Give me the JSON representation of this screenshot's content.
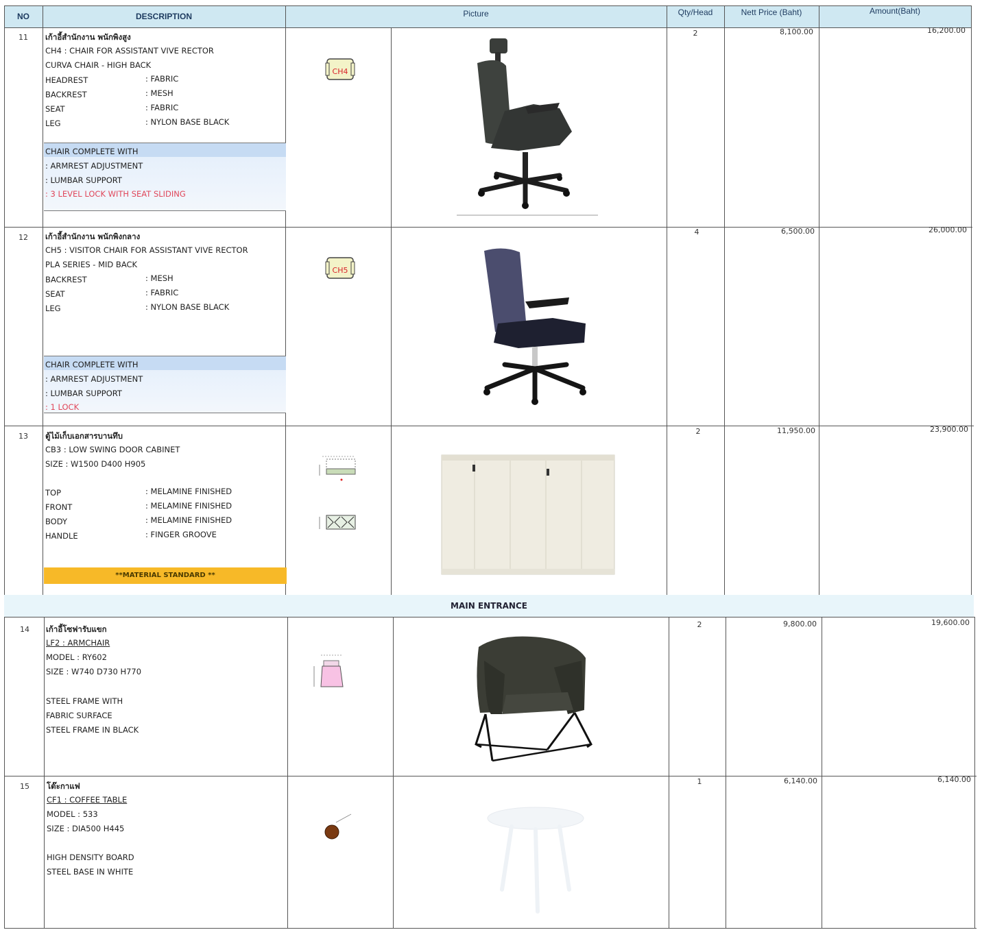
{
  "header": {
    "no": "NO",
    "description": "DESCRIPTION",
    "picture": "Picture",
    "qty": "Qty/Head",
    "price": "Nett Price (Baht)",
    "amount": "Amount(Baht)"
  },
  "section": {
    "main_entrance": "MAIN ENTRANCE"
  },
  "items": [
    {
      "no": "11",
      "thai": "เก้าอี้สำนักงาน พนักพิงสูง",
      "line1": "CH4 : CHAIR FOR ASSISTANT VIVE RECTOR",
      "line2": "CURVA CHAIR - HIGH BACK",
      "specs": [
        {
          "k": "HEADREST",
          "v": ": FABRIC"
        },
        {
          "k": "BACKREST",
          "v": ": MESH"
        },
        {
          "k": "SEAT",
          "v": ": FABRIC"
        },
        {
          "k": "LEG",
          "v": ": NYLON BASE BLACK"
        }
      ],
      "complete_head": "CHAIR COMPLETE WITH",
      "complete": [
        ": ARMREST ADJUSTMENT",
        ": LUMBAR SUPPORT",
        ": 3 LEVEL LOCK WITH SEAT SLIDING"
      ],
      "tag": "CH4",
      "qty": "2",
      "price": "8,100.00",
      "amount": "16,200.00"
    },
    {
      "no": "12",
      "thai": "เก้าอี้สำนักงาน พนักพิงกลาง",
      "line1": "CH5  : VISITOR CHAIR FOR ASSISTANT VIVE RECTOR",
      "line2": "PLA SERIES - MID BACK",
      "specs": [
        {
          "k": "BACKREST",
          "v": ": MESH"
        },
        {
          "k": "SEAT",
          "v": ": FABRIC"
        },
        {
          "k": "LEG",
          "v": ": NYLON BASE BLACK"
        }
      ],
      "complete_head": "CHAIR COMPLETE WITH",
      "complete": [
        ": ARMREST ADJUSTMENT",
        ": LUMBAR SUPPORT",
        ": 1 LOCK"
      ],
      "tag": "CH5",
      "qty": "4",
      "price": "6,500.00",
      "amount": "26,000.00"
    },
    {
      "no": "13",
      "thai": "ตู้ไม้เก็บเอกสารบานทึบ",
      "line1": "CB3 : LOW SWING DOOR CABINET",
      "line2": "SIZE : W1500 D400 H905",
      "specs": [
        {
          "k": "TOP",
          "v": ": MELAMINE FINISHED"
        },
        {
          "k": "FRONT",
          "v": ": MELAMINE FINISHED"
        },
        {
          "k": "BODY",
          "v": ": MELAMINE FINISHED"
        },
        {
          "k": "HANDLE",
          "v": ": FINGER GROOVE"
        }
      ],
      "material": "**MATERIAL STANDARD **",
      "qty": "2",
      "price": "11,950.00",
      "amount": "23,900.00"
    },
    {
      "no": "14",
      "thai": "เก้าอี้โซฟารับแขก",
      "line1": "LF2 : ARMCHAIR",
      "line2": "MODEL : RY602",
      "line3": "SIZE : W740 D730 H770",
      "notes": [
        "STEEL FRAME WITH",
        "FABRIC SURFACE",
        "STEEL FRAME IN BLACK"
      ],
      "qty": "2",
      "price": "9,800.00",
      "amount": "19,600.00"
    },
    {
      "no": "15",
      "thai": "โต๊ะกาแฟ",
      "line1": "CF1 : COFFEE TABLE",
      "line2": "MODEL : 533",
      "line3": "SIZE : DIA500 H445",
      "notes": [
        "HIGH DENSITY BOARD",
        "STEEL BASE IN WHITE"
      ],
      "qty": "1",
      "price": "6,140.00",
      "amount": "6,140.00"
    }
  ]
}
